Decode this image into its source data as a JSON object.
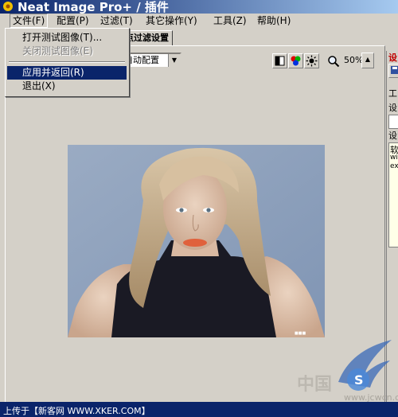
{
  "window": {
    "title": "Neat Image Pro+ / 插件"
  },
  "menubar": [
    {
      "label": "文件(F)"
    },
    {
      "label": "配置(P)"
    },
    {
      "label": "过滤(T)"
    },
    {
      "label": "其它操作(Y)"
    },
    {
      "label": "工具(Z)"
    },
    {
      "label": "帮助(H)"
    }
  ],
  "file_menu": {
    "items": [
      {
        "label": "打开测试图像(T)...",
        "enabled": true
      },
      {
        "label": "关闭测试图像(E)",
        "enabled": false
      },
      {
        "label": "应用并返回(R)",
        "enabled": true,
        "highlighted": true
      },
      {
        "label": "退出(X)",
        "enabled": true
      }
    ]
  },
  "tabs": [
    {
      "label": "点过滤设置"
    }
  ],
  "toolbar": {
    "profile_combo": "自动配置",
    "zoom": "50%",
    "scroll_arrow": "▲"
  },
  "right_panel": {
    "labels": [
      "设",
      "工",
      "设",
      "设",
      "软",
      "wi",
      "ex"
    ]
  },
  "footer": {
    "caption": "上传于【新客网 WWW.XKER.COM】"
  },
  "watermarks": {
    "cn": "中国",
    "site": "www.jcwcn.com"
  },
  "colors": {
    "title_start": "#0a246a",
    "title_end": "#a6caf0",
    "menu_highlight": "#0a246a",
    "face_bg": "#d4d0c8"
  }
}
